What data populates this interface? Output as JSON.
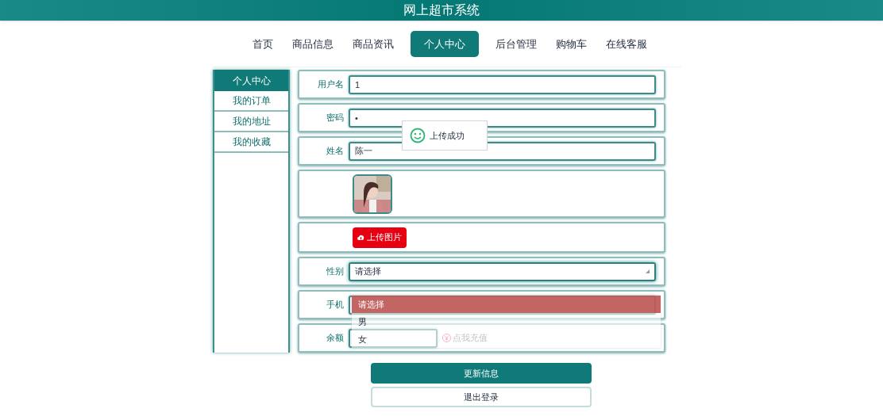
{
  "header": {
    "title": "网上超市系统"
  },
  "nav": [
    {
      "label": "首页",
      "selected": false
    },
    {
      "label": "商品信息",
      "selected": false
    },
    {
      "label": "商品资讯",
      "selected": false
    },
    {
      "label": "个人中心",
      "selected": true
    },
    {
      "label": "后台管理",
      "selected": false
    },
    {
      "label": "购物车",
      "selected": false
    },
    {
      "label": "在线客服",
      "selected": false
    }
  ],
  "sidebar": {
    "items": [
      {
        "label": "个人中心",
        "selected": true
      },
      {
        "label": "我的订单",
        "selected": false
      },
      {
        "label": "我的地址",
        "selected": false
      },
      {
        "label": "我的收藏",
        "selected": false
      }
    ]
  },
  "form": {
    "rows": [
      {
        "kind": "input",
        "label": "用户名",
        "value": "1"
      },
      {
        "kind": "input",
        "label": "密码",
        "value": "•"
      },
      {
        "kind": "input",
        "label": "姓名",
        "value": "陈一"
      },
      {
        "kind": "avatar"
      },
      {
        "kind": "upload",
        "button": "上传图片"
      },
      {
        "kind": "select",
        "label": "性别",
        "placeholder": "请选择",
        "expanded": true,
        "options": [
          {
            "label": "请选择",
            "selected": true
          },
          {
            "label": "男",
            "selected": false
          },
          {
            "label": "女",
            "selected": false
          }
        ]
      },
      {
        "kind": "input",
        "label": "手机"
      },
      {
        "kind": "balance",
        "label": "余额",
        "link": "点我充值"
      }
    ]
  },
  "buttons": [
    {
      "label": "更新信息",
      "kind": "primary"
    },
    {
      "label": "退出登录",
      "kind": "secondary"
    }
  ],
  "toast": {
    "message": "上传成功"
  }
}
